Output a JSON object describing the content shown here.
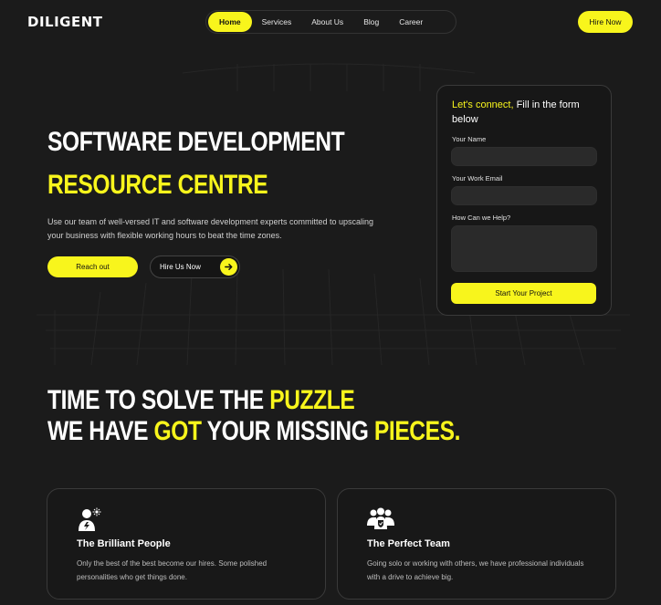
{
  "brand": {
    "logo_text": "DILIGENT"
  },
  "nav": {
    "items": [
      {
        "label": "Home",
        "active": true
      },
      {
        "label": "Services",
        "active": false
      },
      {
        "label": "About Us",
        "active": false
      },
      {
        "label": "Blog",
        "active": false
      },
      {
        "label": "Career",
        "active": false
      }
    ],
    "hire_label": "Hire Now"
  },
  "hero": {
    "title_line1": "SOFTWARE DEVELOPMENT",
    "title_line2": "RESOURCE CENTRE",
    "description": "Use our team of well-versed IT and software development experts committed to upscaling your business with flexible working hours to beat the time zones.",
    "reach_label": "Reach out",
    "hire_us_label": "Hire Us Now"
  },
  "form": {
    "title_highlight": "Let's connect,",
    "title_rest": " Fill in the form below",
    "name_label": "Your Name",
    "name_value": "",
    "email_label": "Your Work Email",
    "email_value": "",
    "help_label": "How Can we Help?",
    "help_value": "",
    "submit_label": "Start Your Project"
  },
  "puzzle": {
    "line1_a": "TIME TO SOLVE THE ",
    "line1_b": "PUZZLE",
    "line2_a": "WE HAVE ",
    "line2_b": "GOT",
    "line2_c": " YOUR MISSING ",
    "line2_d": "PIECES."
  },
  "cards": [
    {
      "icon": "brilliant-person-icon",
      "title": "The Brilliant People",
      "description": "Only the best of the best become our hires. Some polished personalities who get things done."
    },
    {
      "icon": "team-icon",
      "title": "The Perfect Team",
      "description": "Going solo or working with others, we have professional individuals with a drive to achieve big."
    }
  ],
  "colors": {
    "accent": "#f8f51c",
    "background": "#1b1b1b"
  }
}
